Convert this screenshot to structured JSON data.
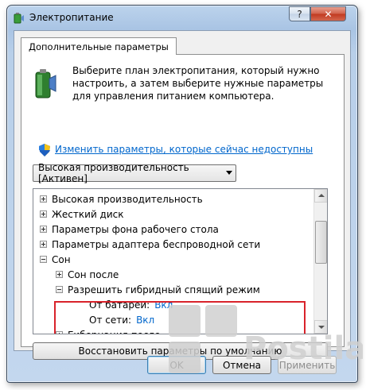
{
  "window": {
    "title": "Электропитание",
    "help_label": "?",
    "close_label": "✕"
  },
  "tab": {
    "label": "Дополнительные параметры"
  },
  "description": "Выберите план электропитания, который нужно настроить, а затем выберите нужные параметры для управления питанием компьютера.",
  "change_link": "Изменить параметры, которые сейчас недоступны",
  "plan_select": {
    "value": "Высокая производительность [Активен]"
  },
  "tree": {
    "items": [
      {
        "label": "Высокая производительность",
        "expander": "plus",
        "level": 0
      },
      {
        "label": "Жесткий диск",
        "expander": "plus",
        "level": 0
      },
      {
        "label": "Параметры фона рабочего стола",
        "expander": "plus",
        "level": 0
      },
      {
        "label": "Параметры адаптера беспроводной сети",
        "expander": "plus",
        "level": 0
      },
      {
        "label": "Сон",
        "expander": "minus",
        "level": 0
      },
      {
        "label": "Сон после",
        "expander": "plus",
        "level": 1
      },
      {
        "label": "Разрешить гибридный спящий режим",
        "expander": "minus",
        "level": 1
      },
      {
        "label": "От батареи:",
        "value": "Вкл",
        "level": 2
      },
      {
        "label": "От сети:",
        "value": "Вкл",
        "level": 2
      },
      {
        "label": "Гибернация после",
        "expander": "plus",
        "level": 1
      }
    ]
  },
  "buttons": {
    "restore": "Восстановить параметры по умолчанию",
    "ok": "OK",
    "cancel": "Отмена",
    "apply": "Применить"
  },
  "watermark": "Postila.ru",
  "colors": {
    "link": "#0066cc",
    "highlight": "#d9232b",
    "watermark": "#d0d0d0"
  }
}
